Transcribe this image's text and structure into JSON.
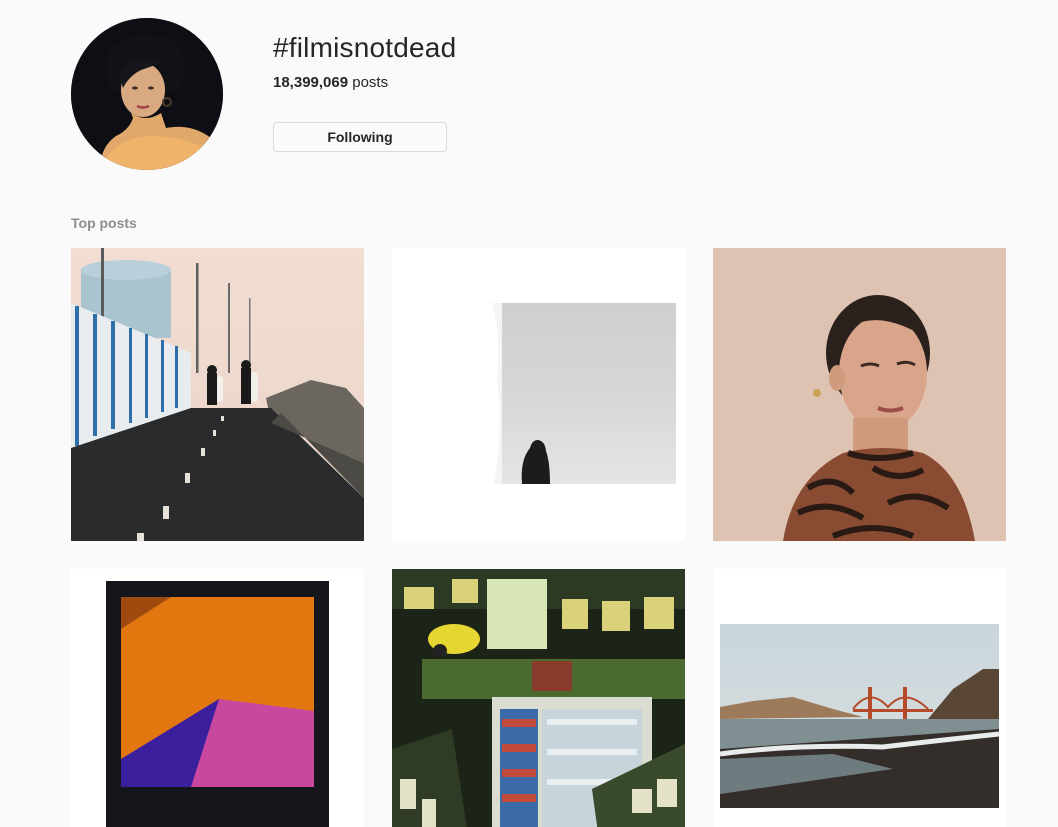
{
  "header": {
    "hashtag": "#filmisnotdead",
    "posts_count": "18,399,069",
    "posts_label": "posts",
    "follow_button": "Following"
  },
  "sections": {
    "top_posts_title": "Top posts"
  },
  "posts": [
    {
      "subject": "surfers-skateboarding-road"
    },
    {
      "subject": "silhouette-fog-white-frame"
    },
    {
      "subject": "woman-portrait-zebra-top"
    },
    {
      "subject": "polaroid-orange-purple"
    },
    {
      "subject": "grocery-store-interior"
    },
    {
      "subject": "golden-gate-beach"
    }
  ],
  "colors": {
    "background": "#fafafa",
    "text": "#262626",
    "secondary_text": "#8e8e8e",
    "border": "#dbdbdb"
  }
}
